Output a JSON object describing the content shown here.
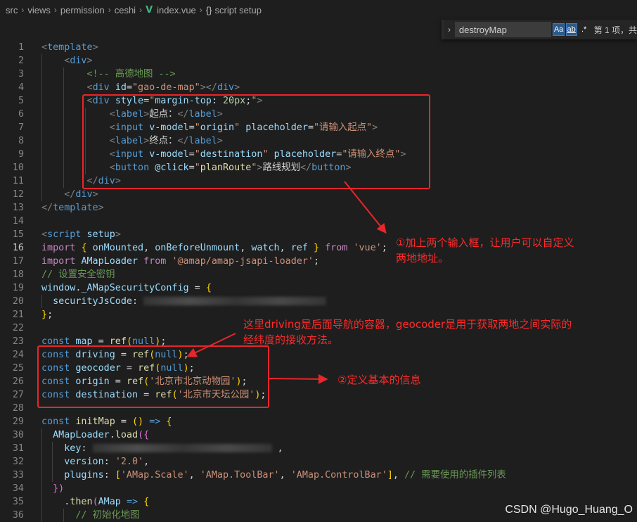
{
  "breadcrumb": {
    "items": [
      "src",
      "views",
      "permission",
      "ceshi"
    ],
    "file": "index.vue",
    "symbol": "script setup"
  },
  "find_widget": {
    "query": "destroyMap",
    "match_case_label": "Aa",
    "whole_word_label": "ab",
    "regex_label": ".*",
    "result_text": "第 1 项，共"
  },
  "code_lines": [
    {
      "n": "1",
      "html": "<span class=\"t-br\">&lt;</span><span class=\"t-tag\">template</span><span class=\"t-br\">&gt;</span>"
    },
    {
      "n": "2",
      "html": "    <span class=\"t-br\">&lt;</span><span class=\"t-tag\">div</span><span class=\"t-br\">&gt;</span>"
    },
    {
      "n": "3",
      "html": "        <span class=\"t-com\">&lt;!-- 高德地图 --&gt;</span>"
    },
    {
      "n": "4",
      "html": "        <span class=\"t-br\">&lt;</span><span class=\"t-tag\">div</span> <span class=\"t-attr\">id</span>=<span class=\"t-str\">\"gao-de-map\"</span><span class=\"t-br\">&gt;&lt;/</span><span class=\"t-tag\">div</span><span class=\"t-br\">&gt;</span>"
    },
    {
      "n": "5",
      "html": "        <span class=\"t-br\">&lt;</span><span class=\"t-tag\">div</span> <span class=\"t-attr\">style</span>=<span class=\"t-str\">\"</span><span class=\"t-attr\">margin-top</span>: <span class=\"t-num\">20px</span>;<span class=\"t-str\">\"</span><span class=\"t-br\">&gt;</span>"
    },
    {
      "n": "6",
      "html": "            <span class=\"t-br\">&lt;</span><span class=\"t-tag\">label</span><span class=\"t-br\">&gt;</span>起点：<span class=\"t-br\">&lt;/</span><span class=\"t-tag\">label</span><span class=\"t-br\">&gt;</span>"
    },
    {
      "n": "7",
      "html": "            <span class=\"t-br\">&lt;</span><span class=\"t-tag\">input</span> <span class=\"t-attr\">v-model</span>=<span class=\"t-str\">\"</span><span class=\"t-var\">origin</span><span class=\"t-str\">\"</span> <span class=\"t-attr\">placeholder</span>=<span class=\"t-str\">\"请输入起点\"</span><span class=\"t-br\">&gt;</span>"
    },
    {
      "n": "8",
      "html": "            <span class=\"t-br\">&lt;</span><span class=\"t-tag\">label</span><span class=\"t-br\">&gt;</span>终点：<span class=\"t-br\">&lt;/</span><span class=\"t-tag\">label</span><span class=\"t-br\">&gt;</span>"
    },
    {
      "n": "9",
      "html": "            <span class=\"t-br\">&lt;</span><span class=\"t-tag\">input</span> <span class=\"t-attr\">v-model</span>=<span class=\"t-str\">\"</span><span class=\"t-var\">destination</span><span class=\"t-str\">\"</span> <span class=\"t-attr\">placeholder</span>=<span class=\"t-str\">\"请输入终点\"</span><span class=\"t-br\">&gt;</span>"
    },
    {
      "n": "10",
      "html": "            <span class=\"t-br\">&lt;</span><span class=\"t-tag\">button</span> <span class=\"t-attr\">@click</span>=<span class=\"t-str\">\"</span><span class=\"t-fn\">planRoute</span><span class=\"t-str\">\"</span><span class=\"t-br\">&gt;</span>路线规划<span class=\"t-br\">&lt;/</span><span class=\"t-tag\">button</span><span class=\"t-br\">&gt;</span>"
    },
    {
      "n": "11",
      "html": "        <span class=\"t-br\">&lt;/</span><span class=\"t-tag\">div</span><span class=\"t-br\">&gt;</span>"
    },
    {
      "n": "12",
      "html": "    <span class=\"t-br\">&lt;/</span><span class=\"t-tag\">div</span><span class=\"t-br\">&gt;</span>"
    },
    {
      "n": "13",
      "html": "<span class=\"t-br\">&lt;/</span><span class=\"t-tag\">template</span><span class=\"t-br\">&gt;</span>"
    },
    {
      "n": "14",
      "html": ""
    },
    {
      "n": "15",
      "html": "<span class=\"t-br\">&lt;</span><span class=\"t-tag\">script</span> <span class=\"t-attr\">setup</span><span class=\"t-br\">&gt;</span>"
    },
    {
      "n": "16",
      "html": "<span class=\"t-kw\">import</span> <span class=\"t-yel\">{</span> <span class=\"t-var\">onMounted</span>, <span class=\"t-var\">onBeforeUnmount</span>, <span class=\"t-var\">watch</span>, <span class=\"t-var\">ref</span> <span class=\"t-yel\">}</span> <span class=\"t-kw\">from</span> <span class=\"t-str\">'vue'</span>;"
    },
    {
      "n": "17",
      "html": "<span class=\"t-kw\">import</span> <span class=\"t-var\">AMapLoader</span> <span class=\"t-kw\">from</span> <span class=\"t-str\">'@amap/amap-jsapi-loader'</span>;"
    },
    {
      "n": "18",
      "html": "<span class=\"t-com\">// 设置安全密钥</span>"
    },
    {
      "n": "19",
      "html": "<span class=\"t-var\">window</span>.<span class=\"t-var\">_AMapSecurityConfig</span> = <span class=\"t-yel\">{</span>"
    },
    {
      "n": "20",
      "html": "  <span class=\"t-var\">securityJsCode</span>: <span class=\"blur\" style=\"width:260px\"></span>"
    },
    {
      "n": "21",
      "html": "<span class=\"t-yel\">}</span>;"
    },
    {
      "n": "22",
      "html": ""
    },
    {
      "n": "23",
      "html": "<span class=\"t-dec\">const</span> <span class=\"t-var\">map</span> = <span class=\"t-fn\">ref</span><span class=\"t-yel\">(</span><span class=\"t-dec\">null</span><span class=\"t-yel\">)</span>;"
    },
    {
      "n": "24",
      "html": "<span class=\"t-dec\">const</span> <span class=\"t-var\">driving</span> = <span class=\"t-fn\">ref</span><span class=\"t-yel\">(</span><span class=\"t-dec\">null</span><span class=\"t-yel\">)</span>;"
    },
    {
      "n": "25",
      "html": "<span class=\"t-dec\">const</span> <span class=\"t-var\">geocoder</span> = <span class=\"t-fn\">ref</span><span class=\"t-yel\">(</span><span class=\"t-dec\">null</span><span class=\"t-yel\">)</span>;"
    },
    {
      "n": "26",
      "html": "<span class=\"t-dec\">const</span> <span class=\"t-var\">origin</span> = <span class=\"t-fn\">ref</span><span class=\"t-yel\">(</span><span class=\"t-str\">'北京市北京动物园'</span><span class=\"t-yel\">)</span>;"
    },
    {
      "n": "27",
      "html": "<span class=\"t-dec\">const</span> <span class=\"t-var\">destination</span> = <span class=\"t-fn\">ref</span><span class=\"t-yel\">(</span><span class=\"t-str\">'北京市天坛公园'</span><span class=\"t-yel\">)</span>;"
    },
    {
      "n": "28",
      "html": ""
    },
    {
      "n": "29",
      "html": "<span class=\"t-dec\">const</span> <span class=\"t-fn\">initMap</span> = <span class=\"t-yel\">()</span> <span class=\"t-dec\">=&gt;</span> <span class=\"t-yel\">{</span>"
    },
    {
      "n": "30",
      "html": "  <span class=\"t-var\">AMapLoader</span>.<span class=\"t-fn\">load</span><span class=\"t-pur\">({</span>"
    },
    {
      "n": "31",
      "html": "    <span class=\"t-var\">key</span>: <span class=\"blur\" style=\"width:255px\"></span> ,"
    },
    {
      "n": "32",
      "html": "    <span class=\"t-var\">version</span>: <span class=\"t-str\">'2.0'</span>,"
    },
    {
      "n": "33",
      "html": "    <span class=\"t-var\">plugins</span>: <span class=\"t-yel\">[</span><span class=\"t-str\">'AMap.Scale'</span>, <span class=\"t-str\">'AMap.ToolBar'</span>, <span class=\"t-str\">'AMap.ControlBar'</span><span class=\"t-yel\">]</span>, <span class=\"t-com\">// 需要使用的插件列表</span>"
    },
    {
      "n": "34",
      "html": "  <span class=\"t-pur\">})</span>"
    },
    {
      "n": "35",
      "html": "    .<span class=\"t-fn\">then</span><span class=\"t-pur\">(</span><span class=\"t-var\">AMap</span> <span class=\"t-dec\">=&gt;</span> <span class=\"t-yel\">{</span>"
    },
    {
      "n": "36",
      "html": "      <span class=\"t-com\">// 初始化地图</span>"
    }
  ],
  "annotations": {
    "note1_line1": "①加上两个输入框，让用户可以自定义",
    "note1_line2": "两地地址。",
    "note2_line1": "这里driving是后面导航的容器，geocoder是用于获取两地之间实际的",
    "note2_line2": "经纬度的接收方法。",
    "note3": "②定义基本的信息"
  },
  "watermark": "CSDN @Hugo_Huang_O",
  "colors": {
    "annotation_red": "#e8262b",
    "editor_bg": "#1e1e1e"
  }
}
